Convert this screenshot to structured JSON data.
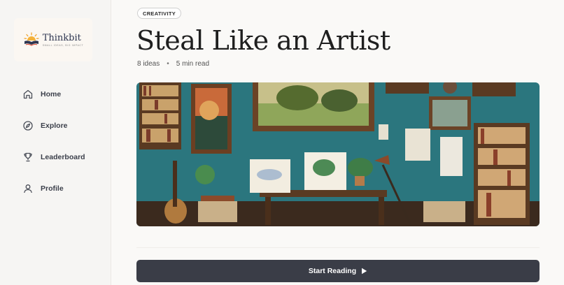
{
  "brand": {
    "name": "Thinkbit",
    "tagline": "small ideas, big impact",
    "icon": "book-sun-logo"
  },
  "sidebar": {
    "items": [
      {
        "label": "Home",
        "icon": "home-icon"
      },
      {
        "label": "Explore",
        "icon": "compass-icon"
      },
      {
        "label": "Leaderboard",
        "icon": "trophy-icon"
      },
      {
        "label": "Profile",
        "icon": "user-icon"
      }
    ]
  },
  "book": {
    "category": "CREATIVITY",
    "title": "Steal Like an Artist",
    "ideas": "8 ideas",
    "separator": "•",
    "read_time": "5 min read",
    "cover": "artist-studio-illustration"
  },
  "cta": {
    "label": "Start Reading",
    "icon": "play-icon"
  },
  "colors": {
    "background": "#faf9f7",
    "button": "#3a3d47",
    "wall": "#2f7e86"
  }
}
